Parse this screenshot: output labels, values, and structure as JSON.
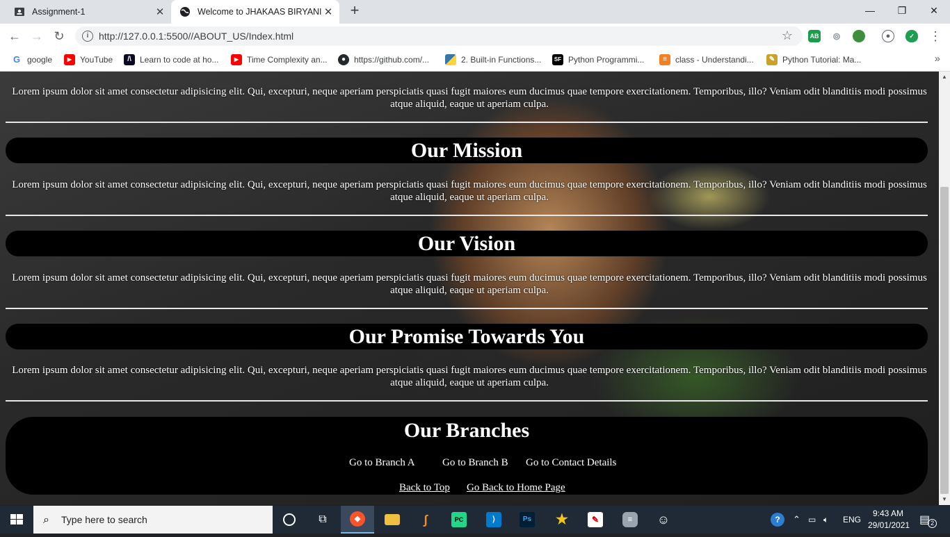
{
  "browser": {
    "tabs": [
      {
        "title": "Assignment-1",
        "active": false
      },
      {
        "title": "Welcome to JHAKAAS BIRYANI",
        "active": true
      }
    ],
    "url": "http://127.0.0.1:5500//ABOUT_US/Index.html",
    "bookmarks": [
      {
        "label": "google",
        "icon": "google-icon"
      },
      {
        "label": "YouTube",
        "icon": "youtube-icon"
      },
      {
        "label": "Learn to code at ho...",
        "icon": "freecodecamp-icon"
      },
      {
        "label": "Time Complexity an...",
        "icon": "youtube-icon"
      },
      {
        "label": "https://github.com/...",
        "icon": "github-icon"
      },
      {
        "label": "2. Built-in Functions...",
        "icon": "python-icon"
      },
      {
        "label": "Python Programmi...",
        "icon": "sourceforge-icon"
      },
      {
        "label": "class - Understandi...",
        "icon": "stackoverflow-icon"
      },
      {
        "label": "Python Tutorial: Ma...",
        "icon": "tutorial-icon"
      }
    ],
    "extensions": [
      {
        "name": "adblock-icon",
        "label": "AB",
        "color": "#1a9e4a"
      },
      {
        "name": "extension-icon",
        "label": "",
        "color": "#9aa0a6"
      },
      {
        "name": "globe-extension-icon",
        "label": "",
        "color": "#3d8f3d"
      },
      {
        "name": "profile-icon",
        "label": "",
        "color": "#5f6368"
      },
      {
        "name": "shield-check-icon",
        "label": "✓",
        "color": "#1e9e50"
      }
    ]
  },
  "page": {
    "intro_text": "Lorem ipsum dolor sit amet consectetur adipisicing elit. Qui, excepturi, neque aperiam perspiciatis quasi fugit maiores eum ducimus quae tempore exercitationem. Temporibus, illo? Veniam odit blanditiis modi possimus atque aliquid, eaque ut aperiam culpa.",
    "sections": [
      {
        "heading": "Our Mission",
        "text": "Lorem ipsum dolor sit amet consectetur adipisicing elit. Qui, excepturi, neque aperiam perspiciatis quasi fugit maiores eum ducimus quae tempore exercitationem. Temporibus, illo? Veniam odit blanditiis modi possimus atque aliquid, eaque ut aperiam culpa."
      },
      {
        "heading": "Our Vision",
        "text": "Lorem ipsum dolor sit amet consectetur adipisicing elit. Qui, excepturi, neque aperiam perspiciatis quasi fugit maiores eum ducimus quae tempore exercitationem. Temporibus, illo? Veniam odit blanditiis modi possimus atque aliquid, eaque ut aperiam culpa."
      },
      {
        "heading": "Our Promise Towards You",
        "text": "Lorem ipsum dolor sit amet consectetur adipisicing elit. Qui, excepturi, neque aperiam perspiciatis quasi fugit maiores eum ducimus quae tempore exercitationem. Temporibus, illo? Veniam odit blanditiis modi possimus atque aliquid, eaque ut aperiam culpa."
      }
    ],
    "footer": {
      "heading": "Our Branches",
      "links": [
        "Go to Branch A",
        "Go to Branch B",
        "Go to Contact Details"
      ],
      "back_to_top": "Back to Top",
      "home": "Go Back to Home Page"
    }
  },
  "taskbar": {
    "search_placeholder": "Type here to search",
    "apps": [
      {
        "name": "cortana-icon"
      },
      {
        "name": "task-view-icon"
      },
      {
        "name": "brave-browser-icon",
        "active": true
      },
      {
        "name": "file-explorer-icon"
      },
      {
        "name": "eclipse-icon"
      },
      {
        "name": "pycharm-icon"
      },
      {
        "name": "vscode-icon"
      },
      {
        "name": "photoshop-icon"
      },
      {
        "name": "star-app-icon"
      },
      {
        "name": "paint-icon"
      },
      {
        "name": "database-icon"
      },
      {
        "name": "emoji-app-icon"
      }
    ],
    "language": "ENG",
    "time": "9:43 AM",
    "date": "29/01/2021",
    "notification_count": "2"
  }
}
